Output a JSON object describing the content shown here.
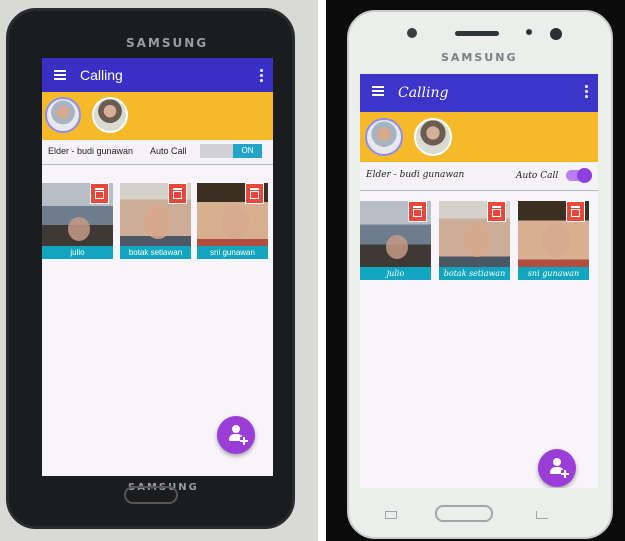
{
  "devices": [
    {
      "brand": "SAMSUNG",
      "app": {
        "title": "Calling",
        "status_text": "Elder - budi gunawan",
        "auto_call_label": "Auto Call",
        "toggle_text": "ON",
        "contacts": [
          {
            "name": "julio"
          },
          {
            "name": "botak setiawan"
          },
          {
            "name": "sni gunawan"
          }
        ]
      }
    },
    {
      "brand": "SAMSUNG",
      "app": {
        "title": "Calling",
        "status_text": "Elder - budi gunawan",
        "auto_call_label": "Auto Call",
        "contacts": [
          {
            "name": "julio"
          },
          {
            "name": "botak setiawan"
          },
          {
            "name": "sni gunawan"
          }
        ]
      }
    }
  ],
  "colors": {
    "app_bar": "#3a2fc4",
    "banner": "#f5b92a",
    "delete": "#e8473c",
    "name_bar": "#11a5bf",
    "fab": "#9b3dd7"
  },
  "icons": [
    "menu-icon",
    "more-vert-icon",
    "trash-icon",
    "add-contact-icon"
  ]
}
